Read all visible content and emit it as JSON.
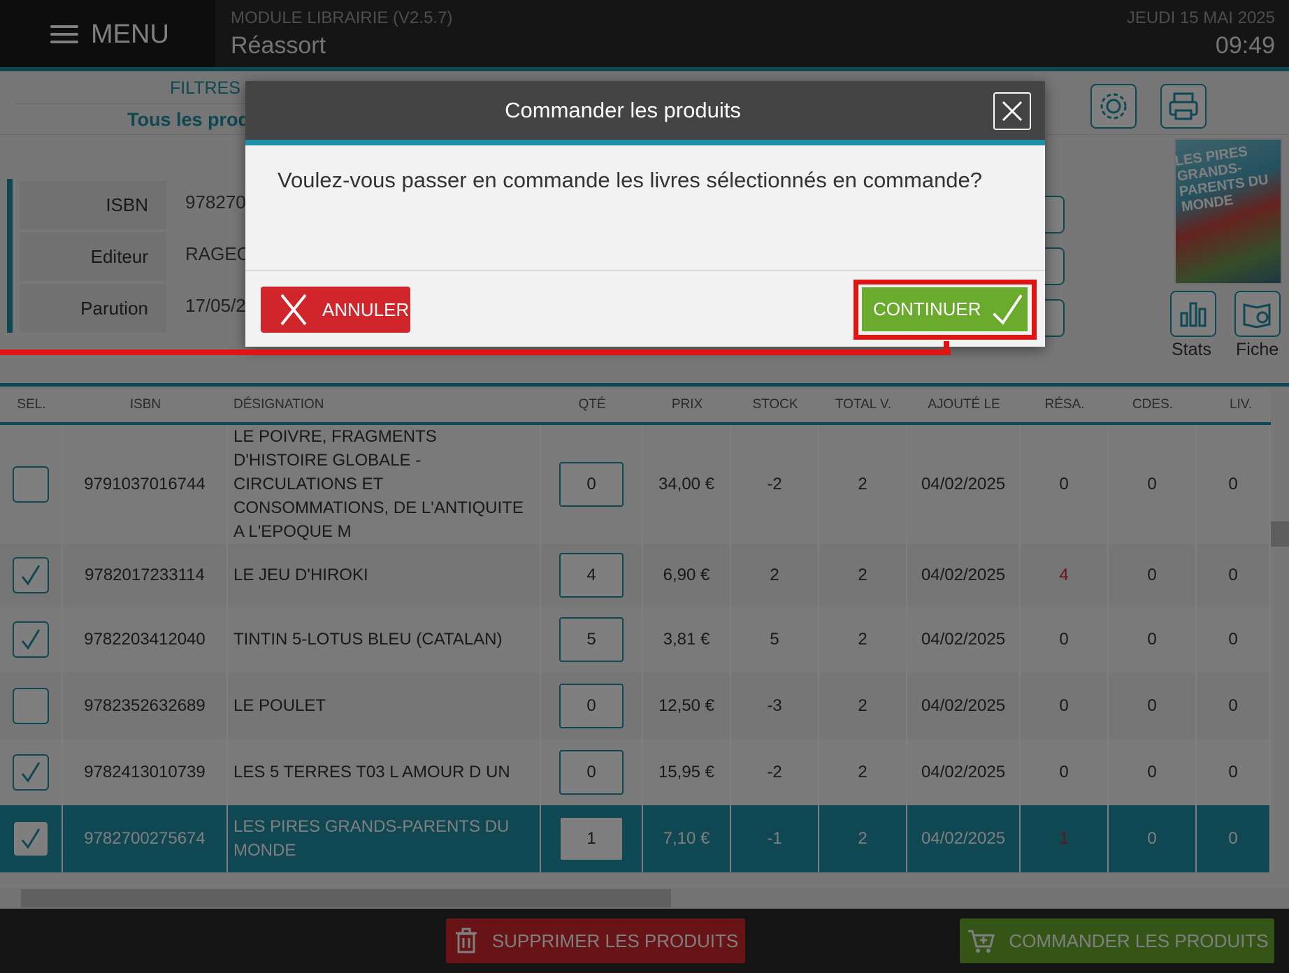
{
  "header": {
    "menu_label": "MENU",
    "module_title": "MODULE LIBRAIRIE (V2.5.7)",
    "page_subtitle": "Réassort",
    "date": "JEUDI 15 MAI 2025",
    "time": "09:49"
  },
  "toolbar": {
    "filters_label": "FILTRES",
    "filter_value": "Tous les prod"
  },
  "detail": {
    "isbn_label": "ISBN",
    "isbn_value": "978270",
    "publisher_label": "Editeur",
    "publisher_value": "RAGEO",
    "release_label": "Parution",
    "release_value": "17/05/2",
    "cover_title": "LES PIRES GRANDS-PARENTS DU MONDE",
    "stats_label": "Stats",
    "sheet_label": "Fiche"
  },
  "table": {
    "columns": [
      "SEL.",
      "ISBN",
      "DÉSIGNATION",
      "QTÉ",
      "PRIX",
      "STOCK",
      "TOTAL V.",
      "AJOUTÉ LE",
      "RÉSA.",
      "CDES.",
      "LIV."
    ],
    "rows": [
      {
        "checked": false,
        "isbn": "9791037016744",
        "designation": "LE POIVRE, FRAGMENTS D'HISTOIRE GLOBALE - CIRCULATIONS ET CONSOMMATIONS, DE L'ANTIQUITE A L'EPOQUE M",
        "qty": "0",
        "price": "34,00 €",
        "stock": "-2",
        "total": "2",
        "added": "04/02/2025",
        "resa": "0",
        "cdes": "0",
        "liv": "0"
      },
      {
        "checked": true,
        "isbn": "9782017233114",
        "designation": "LE JEU D'HIROKI",
        "qty": "4",
        "price": "6,90 €",
        "stock": "2",
        "total": "2",
        "added": "04/02/2025",
        "resa": "4",
        "cdes": "0",
        "liv": "0"
      },
      {
        "checked": true,
        "isbn": "9782203412040",
        "designation": "TINTIN 5-LOTUS BLEU (CATALAN)",
        "qty": "5",
        "price": "3,81 €",
        "stock": "5",
        "total": "2",
        "added": "04/02/2025",
        "resa": "0",
        "cdes": "0",
        "liv": "0"
      },
      {
        "checked": false,
        "isbn": "9782352632689",
        "designation": "LE POULET",
        "qty": "0",
        "price": "12,50 €",
        "stock": "-3",
        "total": "2",
        "added": "04/02/2025",
        "resa": "0",
        "cdes": "0",
        "liv": "0"
      },
      {
        "checked": true,
        "isbn": "9782413010739",
        "designation": "LES 5 TERRES T03 L AMOUR D UN",
        "qty": "0",
        "price": "15,95 €",
        "stock": "-2",
        "total": "2",
        "added": "04/02/2025",
        "resa": "0",
        "cdes": "0",
        "liv": "0"
      },
      {
        "checked": true,
        "isbn": "9782700275674",
        "designation": "LES PIRES GRANDS-PARENTS DU MONDE",
        "qty": "1",
        "price": "7,10 €",
        "stock": "-1",
        "total": "2",
        "added": "04/02/2025",
        "resa": "1",
        "cdes": "0",
        "liv": "0"
      }
    ]
  },
  "bottom": {
    "delete_label": "SUPPRIMER LES PRODUITS",
    "order_label": "COMMANDER LES PRODUITS"
  },
  "dialog": {
    "title": "Commander les produits",
    "message": "Voulez-vous passer en commande les livres sélectionnés en commande?",
    "cancel_label": "ANNULER",
    "continue_label": "CONTINUER"
  },
  "colors": {
    "accent": "#1e8fa6",
    "danger": "#d0262b",
    "success": "#6aaa2c",
    "highlight": "#e11414"
  }
}
